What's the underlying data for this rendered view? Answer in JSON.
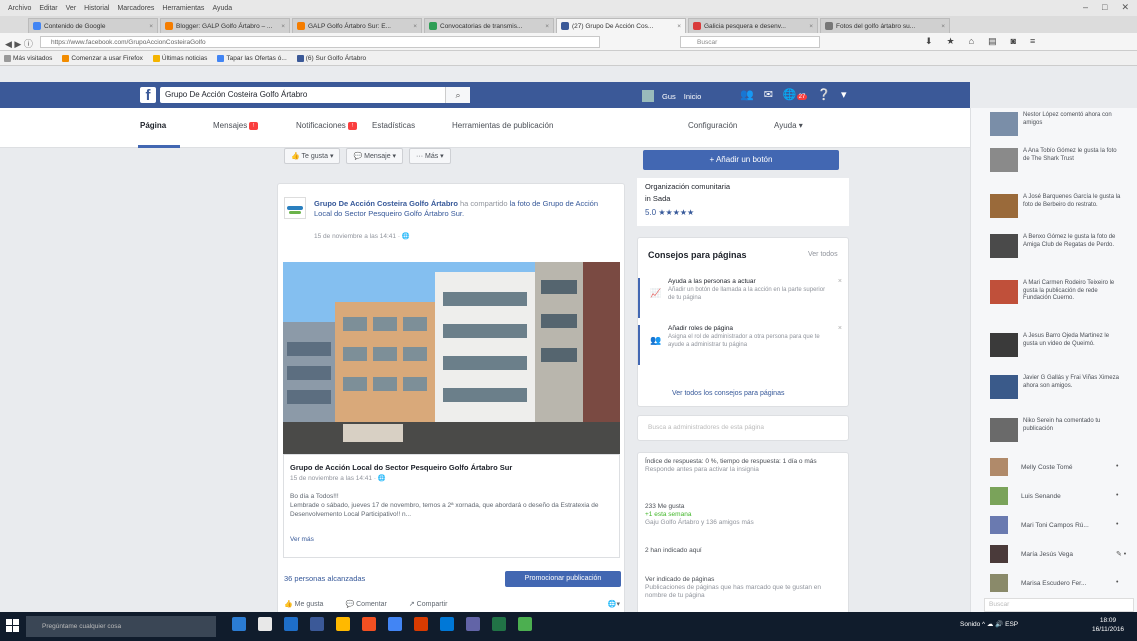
{
  "browser": {
    "menu": [
      "Archivo",
      "Editar",
      "Ver",
      "Historial",
      "Marcadores",
      "Herramientas",
      "Ayuda"
    ],
    "tabs": [
      {
        "label": "Contenido de Google",
        "color": "#4285f4",
        "active": false
      },
      {
        "label": "Blogger: GALP Golfo Ártabro – ...",
        "color": "#f57d00",
        "active": false
      },
      {
        "label": "GALP Golfo Ártabro Sur: E...",
        "color": "#f57d00",
        "active": false
      },
      {
        "label": "Convocatorias de transmis...",
        "color": "#2e9e55",
        "active": false
      },
      {
        "label": "(27) Grupo De Acción Cos...",
        "color": "#3b5998",
        "active": true
      },
      {
        "label": "Galicia pesquera e desenv...",
        "color": "#d93b3b",
        "active": false
      },
      {
        "label": "Fotos del golfo ártabro su...",
        "color": "#777777",
        "active": false
      }
    ],
    "url": "https://www.facebook.com/GrupoAccionCosteiraGolfo",
    "search_placeholder": "Buscar",
    "bookmarks": [
      {
        "label": "Más visitados",
        "color": "#999"
      },
      {
        "label": "Comenzar a usar Firefox",
        "color": "#f28c00"
      },
      {
        "label": "Últimas noticias",
        "color": "#f4b400"
      },
      {
        "label": "Tapar las Ofertas ó...",
        "color": "#4285f4"
      },
      {
        "label": "(6) Sur Golfo Ártabro",
        "color": "#3b5998"
      }
    ]
  },
  "fb": {
    "logo": "f",
    "search_value": "Grupo De Acción Costeira Golfo Ártabro",
    "user_name": "Gus",
    "home_label": "Inicio",
    "notif_count": "27",
    "page_tabs": [
      {
        "label": "Página",
        "active": true
      },
      {
        "label": "Mensajes",
        "badge": true
      },
      {
        "label": "Notificaciones",
        "badge": true
      },
      {
        "label": "Estadísticas"
      },
      {
        "label": "Herramientas de publicación"
      },
      {
        "label": "Configuración"
      },
      {
        "label": "Ayuda ▾"
      }
    ],
    "action_buttons": [
      "👍 Te gusta ▾",
      "💬 Mensaje ▾",
      "··· Más ▾"
    ]
  },
  "post": {
    "author": "Grupo De Acción Costeira Golfo Ártabro",
    "shared_text": " ha compartido",
    "photo_of": "la foto de Grupo de Acción Local do Sector Pesqueiro Golfo Ártabro Sur.",
    "date": "15 de noviembre a las 14:41 · 🌐",
    "link_title": "Grupo de Acción Local do Sector Pesqueiro Golfo Ártabro Sur",
    "link_date": "15 de noviembre a las 14:41 · 🌐",
    "link_desc_1": "Bo día a Todos!!!",
    "link_desc_2": "Lembrade o sábado, jueves 17 de novembro, temos a 2ª xornada, que abordará o deseño da Estratexia de Desenvolvemento Local Participativo!! n...",
    "see_more": "Ver más",
    "reach": "36 personas alcanzadas",
    "promote": "Promocionar publicación",
    "actions": [
      "👍 Me gusta",
      "💬 Comentar",
      "↗ Compartir",
      "🌐▾"
    ]
  },
  "right": {
    "add_button": "+ Añadir un botón",
    "about_type": "Organización comunitaria",
    "about_city": "in Sada",
    "rating": "5.0 ★★★★★",
    "tips_title": "Consejos para páginas",
    "tips_see_all": "Ver todos",
    "tips": [
      {
        "icon": "📈",
        "title": "Ayuda a las personas a actuar",
        "desc": "Añadir un botón de llamada a la acción en la parte superior de tu página"
      },
      {
        "icon": "👥",
        "title": "Añadir roles de página",
        "desc": "Asigna el rol de administrador a otra persona para que te ayude a administrar tu página"
      }
    ],
    "tips_all_link": "Ver todos los consejos para páginas",
    "msg_search_placeholder": "Busca a administradores de esta página",
    "stats": [
      {
        "text": "Índice de respuesta: 0 %, tiempo de respuesta: 1 día o más",
        "sub": "Responde antes para activar la insignia"
      },
      {
        "text": "233 Me gusta",
        "green": "+1 esta semana",
        "sub": "Gaju Golfo Ártabro y 136 amigos más"
      },
      {
        "text": "2 han indicado aquí",
        "green": "",
        "sub": ""
      },
      {
        "text": "Ver indicado de páginas",
        "green": "",
        "sub": "Publicaciones de páginas que has marcado que te gustan en nombre de tu página"
      }
    ]
  },
  "sidebar": {
    "feed": [
      {
        "text": "Nestor López comentó ahora con amigos",
        "color": "#7a8ea8"
      },
      {
        "text": "A Ana Tobío Gómez le gusta la foto de The Shark Trust",
        "color": "#8a8a8a"
      },
      {
        "text": "A José Barquenes García le gusta la foto de Berbeiro do restrato.",
        "color": "#9a6a3a"
      },
      {
        "text": "A Benxo Gómez le gusta la foto de Amiga Club de Regatas de Perdo.",
        "color": "#4a4a4a"
      },
      {
        "text": "A Mari Carmen Rodeiro Teixeiro le gusta la publicación de rede Fundación Cuerno.",
        "color": "#c0503a"
      },
      {
        "text": "A Jesus Barro Ojeda Martinez le gusta un video de Queimó.",
        "color": "#3a3a3a"
      },
      {
        "text": "Javier G Gallás y Frai Viñas Ximeza ahora son amigos.",
        "color": "#3a5a8a"
      },
      {
        "text": "Niko Serein ha comentado tu publicación",
        "color": "#6a6a6a"
      }
    ],
    "chat": [
      {
        "name": "Melly Coste Tomé",
        "color": "#b08a6a",
        "extra": "•"
      },
      {
        "name": "Luis Senande",
        "color": "#7aa35a",
        "extra": "•"
      },
      {
        "name": "Mari Toni Campos Rú...",
        "color": "#6a7ab0",
        "extra": "•"
      },
      {
        "name": "María Jesús Vega",
        "color": "#4a3a3a",
        "extra": "✎ •"
      },
      {
        "name": "Marisa Escudero Fer...",
        "color": "#8a8a6a",
        "extra": "•"
      }
    ],
    "chat_search": "Buscar"
  },
  "taskbar": {
    "cortana": "Pregúntame cualquier cosa",
    "tray": "Sonido ^ ☁ 🔊 ESP",
    "time": "18:09",
    "date": "16/11/2016",
    "app_colors": [
      "#2b7cd3",
      "#e8e8e8",
      "#1e6ec8",
      "#3b5998",
      "#ffb900",
      "#f25022",
      "#4285f4",
      "#d83b01",
      "#0078d7",
      "#6264a7",
      "#217346",
      "#4caf50"
    ]
  }
}
